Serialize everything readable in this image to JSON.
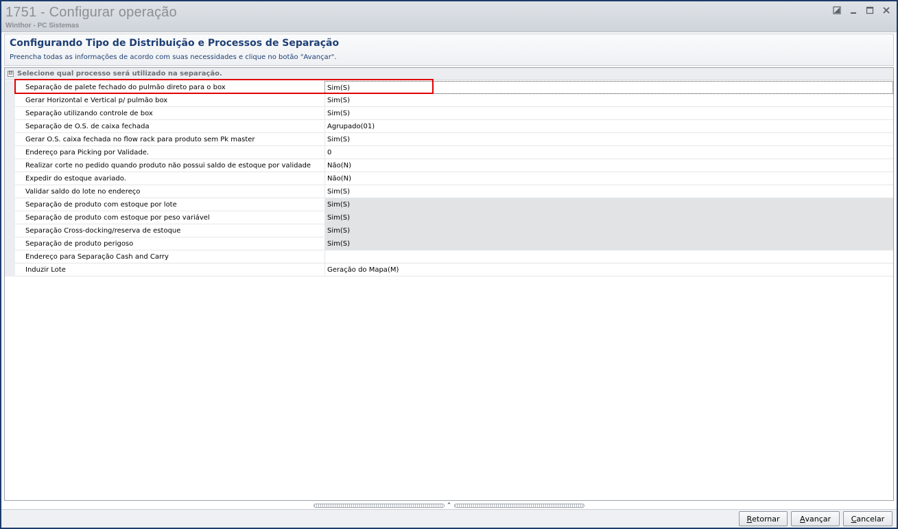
{
  "window": {
    "title": "1751 - Configurar operação",
    "subtitle": "Winthor - PC Sistemas",
    "controls": [
      "restore-icon",
      "minimize-icon",
      "maximize-icon",
      "close-icon"
    ]
  },
  "header": {
    "title": "Configurando Tipo de Distribuição e Processos de Separação",
    "description": "Preencha todas as informações de acordo com suas necessidades e clique no botão \"Avançar\"."
  },
  "group": {
    "toggle": "⊟",
    "label": "Selecione qual processo será utilizado na separação."
  },
  "properties": [
    {
      "name": "Separação de palete fechado do pulmão direto para o box",
      "value": "Sim(S)",
      "disabled": false,
      "selected": true
    },
    {
      "name": "Gerar Horizontal e Vertical p/ pulmão box",
      "value": "Sim(S)",
      "disabled": false,
      "selected": false
    },
    {
      "name": "Separação utilizando controle de box",
      "value": "Sim(S)",
      "disabled": false,
      "selected": false
    },
    {
      "name": "Separação de O.S. de caixa fechada",
      "value": "Agrupado(01)",
      "disabled": false,
      "selected": false
    },
    {
      "name": "Gerar O.S. caixa fechada no flow rack para produto sem Pk master",
      "value": "Sim(S)",
      "disabled": false,
      "selected": false
    },
    {
      "name": "Endereço para Picking por Validade.",
      "value": "0",
      "disabled": false,
      "selected": false
    },
    {
      "name": "Realizar corte no pedido quando produto não possui saldo de estoque por validade",
      "value": "Não(N)",
      "disabled": false,
      "selected": false
    },
    {
      "name": "Expedir do estoque avariado.",
      "value": "Não(N)",
      "disabled": false,
      "selected": false
    },
    {
      "name": "Validar saldo do lote no endereço",
      "value": "Sim(S)",
      "disabled": false,
      "selected": false
    },
    {
      "name": "Separação de produto com estoque por lote",
      "value": "Sim(S)",
      "disabled": true,
      "selected": false
    },
    {
      "name": "Separação de produto com estoque por peso variável",
      "value": "Sim(S)",
      "disabled": true,
      "selected": false
    },
    {
      "name": "Separação Cross-docking/reserva de estoque",
      "value": "Sim(S)",
      "disabled": true,
      "selected": false
    },
    {
      "name": "Separação de produto perigoso",
      "value": "Sim(S)",
      "disabled": true,
      "selected": false
    },
    {
      "name": "Endereço para Separação Cash and Carry",
      "value": "",
      "disabled": false,
      "selected": false
    },
    {
      "name": "Induzir Lote",
      "value": "Geração do Mapa(M)",
      "disabled": false,
      "selected": false
    }
  ],
  "splitter": {
    "caret": "⌃"
  },
  "buttons": {
    "retornar": {
      "mnemonic": "R",
      "rest": "etornar"
    },
    "avancar": {
      "mnemonic": "A",
      "rest": "vançar"
    },
    "cancelar": {
      "mnemonic": "C",
      "rest": "ancelar"
    }
  },
  "colors": {
    "title_text": "#8c8f93",
    "header_text": "#1e3f74",
    "highlight": "#e00000",
    "disabled_cell": "#e2e3e5"
  }
}
